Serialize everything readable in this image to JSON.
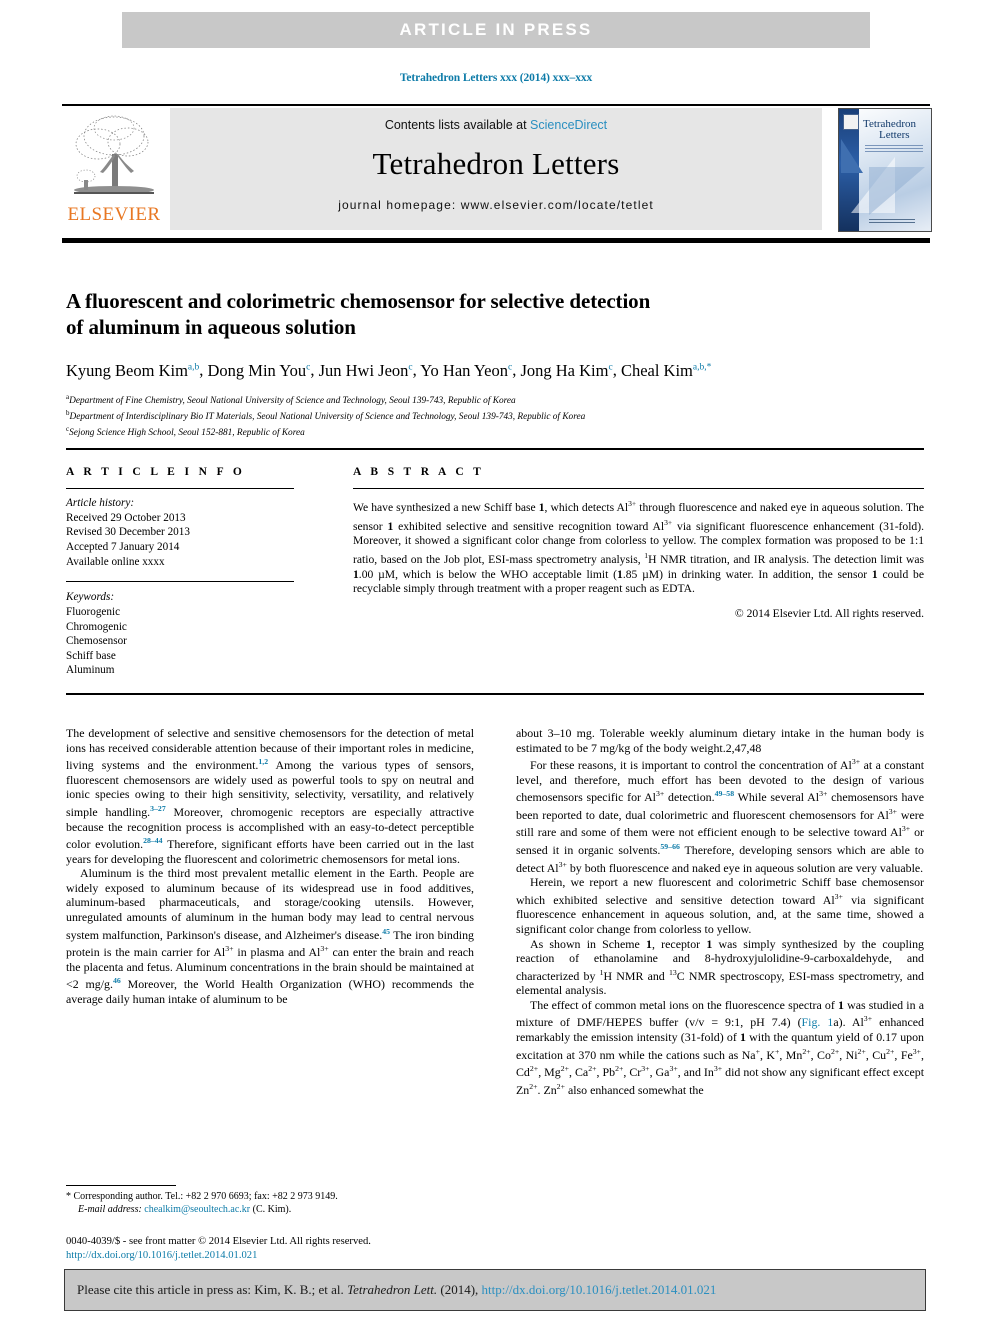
{
  "banner": {
    "label": "ARTICLE  IN  PRESS"
  },
  "running_head": "Tetrahedron Letters xxx (2014) xxx–xxx",
  "masthead": {
    "contents_prefix": "Contents lists available at ",
    "sciencedirect": "ScienceDirect",
    "journal_name": "Tetrahedron Letters",
    "homepage": "journal homepage: www.elsevier.com/locate/tetlet",
    "publisher": "ELSEVIER",
    "cover_title_line1": "Tetrahedron",
    "cover_title_line2": "Letters"
  },
  "title": {
    "line1": "A fluorescent and colorimetric chemosensor for selective detection",
    "line2": "of aluminum in aqueous solution"
  },
  "authors": [
    {
      "name": "Kyung Beom Kim",
      "sup": "a,b"
    },
    {
      "name": "Dong Min You",
      "sup": "c"
    },
    {
      "name": "Jun Hwi Jeon",
      "sup": "c"
    },
    {
      "name": "Yo Han Yeon",
      "sup": "c"
    },
    {
      "name": "Jong Ha Kim",
      "sup": "c"
    },
    {
      "name": "Cheal Kim",
      "sup": "a,b,*"
    }
  ],
  "affiliations": [
    {
      "mark": "a",
      "text": "Department of Fine Chemistry, Seoul National University of Science and Technology, Seoul 139-743, Republic of Korea"
    },
    {
      "mark": "b",
      "text": "Department of Interdisciplinary Bio IT Materials, Seoul National University of Science and Technology, Seoul 139-743, Republic of Korea"
    },
    {
      "mark": "c",
      "text": "Sejong Science High School, Seoul 152-881, Republic of Korea"
    }
  ],
  "article_info": {
    "heading": "A R T I C L E    I N F O",
    "history_label": "Article history:",
    "history": [
      "Received 29 October 2013",
      "Revised 30 December 2013",
      "Accepted 7 January 2014",
      "Available online xxxx"
    ],
    "keywords_label": "Keywords:",
    "keywords": [
      "Fluorogenic",
      "Chromogenic",
      "Chemosensor",
      "Schiff base",
      "Aluminum"
    ]
  },
  "abstract": {
    "heading": "A B S T R A C T",
    "text": "We have synthesized a new Schiff base 1, which detects Al3+ through fluorescence and naked eye in aqueous solution. The sensor 1 exhibited selective and sensitive recognition toward Al3+ via significant fluorescence enhancement (31-fold). Moreover, it showed a significant color change from colorless to yellow. The complex formation was proposed to be 1:1 ratio, based on the Job plot, ESI-mass spectrometry analysis, 1H NMR titration, and IR analysis. The detection limit was 1.00 µM, which is below the WHO acceptable limit (1.85 µM) in drinking water. In addition, the sensor 1 could be recyclable simply through treatment with a proper reagent such as EDTA.",
    "copyright": "© 2014 Elsevier Ltd. All rights reserved."
  },
  "body": {
    "left_paragraphs": [
      "The development of selective and sensitive chemosensors for the detection of metal ions has received considerable attention because of their important roles in medicine, living systems and the environment.1,2 Among the various types of sensors, fluorescent chemosensors are widely used as powerful tools to spy on neutral and ionic species owing to their high sensitivity, selectivity, versatility, and relatively simple handling.3–27 Moreover, chromogenic receptors are especially attractive because the recognition process is accomplished with an easy-to-detect perceptible color evolution.28–44 Therefore, significant efforts have been carried out in the last years for developing the fluorescent and colorimetric chemosensors for metal ions.",
      "Aluminum is the third most prevalent metallic element in the Earth. People are widely exposed to aluminum because of its widespread use in food additives, aluminum-based pharmaceuticals, and storage/cooking utensils. However, unregulated amounts of aluminum in the human body may lead to central nervous system malfunction, Parkinson's disease, and Alzheimer's disease.45 The iron binding protein is the main carrier for Al3+ in plasma and Al3+ can enter the brain and reach the placenta and fetus. Aluminum concentrations in the brain should be maintained at <2 mg/g.46 Moreover, the World Health Organization (WHO) recommends the average daily human intake of aluminum to be"
    ],
    "right_paragraphs": [
      "about 3–10 mg. Tolerable weekly aluminum dietary intake in the human body is estimated to be 7 mg/kg of the body weight.2,47,48",
      "For these reasons, it is important to control the concentration of Al3+ at a constant level, and therefore, much effort has been devoted to the design of various chemosensors specific for Al3+ detection.49–58 While several Al3+ chemosensors have been reported to date, dual colorimetric and fluorescent chemosensors for Al3+ were still rare and some of them were not efficient enough to be selective toward Al3+ or sensed it in organic solvents.59–66 Therefore, developing sensors which are able to detect Al3+ by both fluorescence and naked eye in aqueous solution are very valuable.",
      "Herein, we report a new fluorescent and colorimetric Schiff base chemosensor which exhibited selective and sensitive detection toward Al3+ via significant fluorescence enhancement in aqueous solution, and, at the same time, showed a significant color change from colorless to yellow.",
      "As shown in Scheme 1, receptor 1 was simply synthesized by the coupling reaction of ethanolamine and 8-hydroxyjulolidine-9-carboxaldehyde, and characterized by 1H NMR and 13C NMR spectroscopy, ESI-mass spectrometry, and elemental analysis.",
      "The effect of common metal ions on the fluorescence spectra of 1 was studied in a mixture of DMF/HEPES buffer (v/v = 9:1, pH 7.4) (Fig. 1a). Al3+ enhanced remarkably the emission intensity (31-fold) of 1 with the quantum yield of 0.17 upon excitation at 370 nm while the cations such as Na+, K+, Mn2+, Co2+, Ni2+, Cu2+, Fe3+, Cd2+, Mg2+, Ca2+, Pb2+, Cr3+, Ga3+, and In3+ did not show any significant effect except Zn2+. Zn2+ also enhanced somewhat the"
    ]
  },
  "footnote": {
    "marker": "*",
    "corresponding": "Corresponding author. Tel.: +82 2 970 6693; fax: +82 2 973 9149.",
    "email_label": "E-mail address:",
    "email": "chealkim@seoultech.ac.kr",
    "email_owner": "(C. Kim)."
  },
  "issn": {
    "text": "0040-4039/$ - see front matter © 2014 Elsevier Ltd. All rights reserved.",
    "doi": "http://dx.doi.org/10.1016/j.tetlet.2014.01.021"
  },
  "cite_box": {
    "prefix": "Please cite this article in press as: Kim, K. B.; et al. ",
    "journal": "Tetrahedron Lett.",
    "middle": " (2014), ",
    "doi": "http://dx.doi.org/10.1016/j.tetlet.2014.01.021"
  },
  "colors": {
    "link": "#0d7ba8",
    "sciencedirect": "#2a8fc0",
    "elsevier_orange": "#e87722",
    "banner_gray": "#c8c8c8",
    "masthead_gray": "#e6e6e6"
  }
}
